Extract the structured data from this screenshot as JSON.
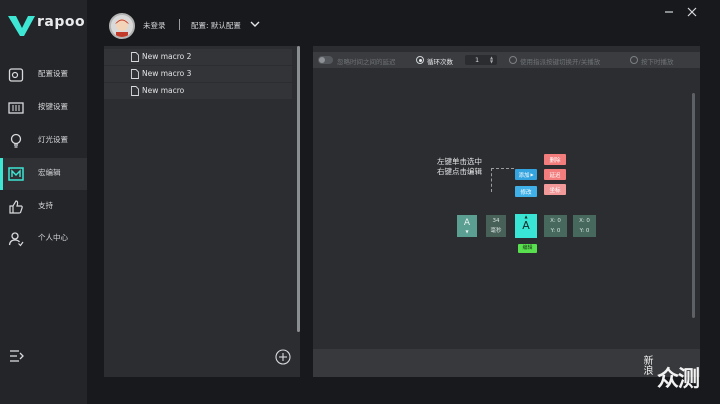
{
  "brand": {
    "name": "rapoo",
    "accent": "#3ee6d4"
  },
  "sidebar": {
    "items": [
      {
        "label": "配置设置",
        "icon": "settings-icon"
      },
      {
        "label": "按键设置",
        "icon": "keyboard-icon"
      },
      {
        "label": "灯光设置",
        "icon": "lightbulb-icon"
      },
      {
        "label": "宏编辑",
        "icon": "macro-icon",
        "active": true
      },
      {
        "label": "支持",
        "icon": "thumbs-up-icon"
      },
      {
        "label": "个人中心",
        "icon": "user-icon"
      }
    ],
    "collapse_icon": "collapse-icon"
  },
  "header": {
    "user_name": "未登录",
    "config_label": "配置: 默认配置"
  },
  "macro_list": {
    "items": [
      "New macro 2",
      "New macro 3",
      "New macro"
    ]
  },
  "toolbar": {
    "ignore_delay": "忽略时间之间的延迟",
    "loop_count_label": "循环次数",
    "loop_count_value": "1",
    "toggle_mode": "使用指派按键切换开/关播放",
    "press_play": "按下时播放"
  },
  "editor": {
    "hint_line1": "左键单击选中",
    "hint_line2": "右键点击编辑",
    "menu": {
      "delete": "删除",
      "delay": "延迟",
      "coord": "坐标",
      "add": "添加",
      "modify": "修改"
    },
    "key_a": "A",
    "delay_value": "34",
    "delay_unit": "毫秒",
    "coord1": {
      "x": "X: 0",
      "y": "Y: 0"
    },
    "coord2": {
      "x": "X: 0",
      "y": "Y: 0"
    },
    "edit_tag": "编辑"
  },
  "watermark": {
    "logo": "新浪",
    "text": "众测"
  }
}
